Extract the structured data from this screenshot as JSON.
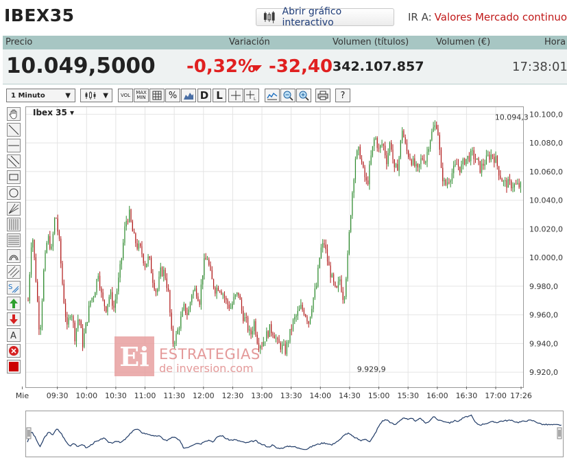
{
  "header": {
    "title": "IBEX35",
    "interactive_button": "Abrir gráfico interactivo",
    "goto_label": "IR A:",
    "goto_link": "Valores Mercado continuo"
  },
  "columns": {
    "price": "Precio",
    "change": "Variación",
    "volume_shares": "Volumen (títulos)",
    "volume_eur": "Volumen (€)",
    "time": "Hora"
  },
  "values": {
    "price": "10.049,5000",
    "change_pct": "-0,32%",
    "change_abs": "-32,40",
    "volume_shares": "342.107.857",
    "time": "17:38:01"
  },
  "toolbar": {
    "interval": "1 Minuto",
    "vol": "VOL",
    "maxmin": "MAX MIN",
    "pct": "%",
    "d": "D",
    "l": "L",
    "help": "?"
  },
  "side_tools": [
    "hand",
    "trendline",
    "horizontal-line",
    "channel",
    "rectangle",
    "ellipse",
    "fan",
    "vertical-grid",
    "horizontal-grid",
    "arc",
    "parallel-lines",
    "s-tool",
    "up-arrow",
    "down-arrow",
    "text",
    "delete",
    "color"
  ],
  "colors": {
    "up": "#2e8b2e",
    "down": "#b01818",
    "header_bar": "#a7c6c3",
    "accent_red": "#e02020",
    "nav_line": "#1f3a66"
  },
  "chart_data": {
    "type": "line",
    "title": "Ibex 35",
    "xlabel": "",
    "ylabel": "",
    "ylim": [
      9910,
      10105
    ],
    "x_ticks": [
      "Mie",
      "09:30",
      "10:00",
      "10:30",
      "11:00",
      "11:30",
      "12:00",
      "12:30",
      "13:00",
      "13:30",
      "14:00",
      "14:30",
      "15:00",
      "15:30",
      "16:00",
      "16:30",
      "17:00",
      "17:26"
    ],
    "y_ticks": [
      "10.100,0",
      "10.080,0",
      "10.060,0",
      "10.040,0",
      "10.020,0",
      "10.000,0",
      "9.980,0",
      "9.960,0",
      "9.940,0",
      "9.920,0"
    ],
    "y_tick_values": [
      10100,
      10080,
      10060,
      10040,
      10020,
      10000,
      9980,
      9960,
      9940,
      9920
    ],
    "annotations": [
      {
        "text": "10.094,3",
        "x": "17:22",
        "y": 10094.3
      },
      {
        "text": "9.929,9",
        "x": "14:58",
        "y": 9929.9
      }
    ],
    "series": [
      {
        "x_minutes": [
          0,
          4,
          8,
          12,
          16,
          20,
          24,
          28,
          32,
          36,
          40,
          44,
          48,
          52,
          56,
          60,
          64,
          68,
          72,
          76,
          80,
          84,
          88,
          92,
          96,
          100,
          104,
          108,
          112,
          116,
          120,
          124,
          128,
          132,
          136,
          140,
          144,
          148,
          152,
          156,
          160,
          164,
          168,
          172,
          176,
          180,
          184,
          188,
          192,
          196,
          200,
          204,
          208,
          212,
          216,
          220,
          224,
          228,
          232,
          236,
          240,
          244,
          248,
          252,
          256,
          260,
          264,
          268,
          272,
          276,
          280,
          284,
          288,
          292,
          296,
          300,
          304,
          308,
          312,
          316,
          320,
          324,
          328,
          332,
          336,
          340,
          344,
          348,
          352,
          356,
          360,
          364,
          368,
          372,
          376,
          380,
          384,
          388,
          392,
          396,
          400,
          404,
          408,
          412,
          416,
          420,
          424,
          428,
          432,
          436,
          440,
          444,
          448,
          452,
          456,
          460,
          464,
          468,
          472,
          476,
          480,
          484,
          488,
          506
        ],
        "y": [
          9970,
          10020,
          9985,
          9945,
          9990,
          10015,
          10005,
          10032,
          10010,
          9975,
          9950,
          9965,
          9945,
          9960,
          9940,
          9955,
          9970,
          9975,
          9990,
          9970,
          9965,
          9975,
          9965,
          9980,
          10000,
          10025,
          10030,
          10015,
          10008,
          10005,
          9995,
          10000,
          9985,
          9975,
          9990,
          9990,
          9975,
          9940,
          9945,
          9955,
          9965,
          9960,
          9975,
          9978,
          9970,
          9995,
          10000,
          9985,
          9978,
          9980,
          9975,
          9968,
          9965,
          9972,
          9975,
          9960,
          9955,
          9945,
          9955,
          9940,
          9940,
          9945,
          9950,
          9948,
          9940,
          9938,
          9935,
          9945,
          9955,
          9960,
          9965,
          9962,
          9955,
          9970,
          9980,
          10005,
          10010,
          9995,
          9985,
          9975,
          9985,
          9970,
          10000,
          10040,
          10070,
          10075,
          10060,
          10050,
          10070,
          10085,
          10075,
          10080,
          10068,
          10082,
          10060,
          10065,
          10090,
          10075,
          10070,
          10065,
          10060,
          10070,
          10068,
          10082,
          10090,
          10094,
          10060,
          10050,
          10055,
          10060,
          10065,
          10062,
          10068,
          10070,
          10072,
          10068,
          10062,
          10066,
          10070,
          10072,
          10068,
          10058,
          10052,
          10049.5
        ]
      }
    ]
  }
}
